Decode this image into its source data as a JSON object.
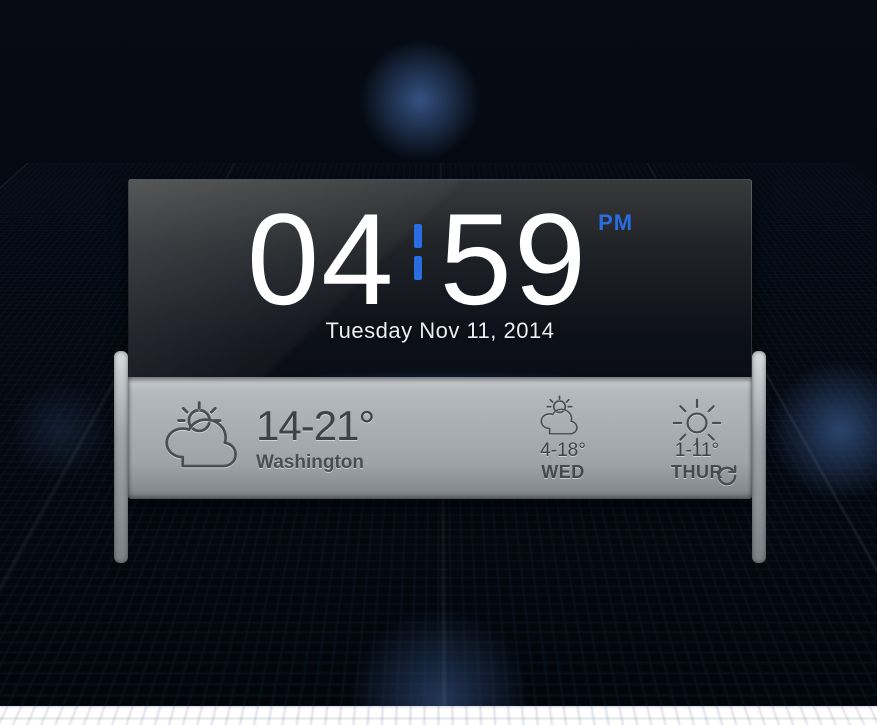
{
  "clock": {
    "hour": "04",
    "minute": "59",
    "ampm": "PM",
    "date": "Tuesday Nov 11, 2014"
  },
  "weather": {
    "today": {
      "icon": "partly-cloudy",
      "temp_range": "14-21°",
      "location": "Washington"
    },
    "forecast": [
      {
        "icon": "partly-cloudy",
        "temp_range": "4-18°",
        "day": "WED"
      },
      {
        "icon": "sunny",
        "temp_range": "1-11°",
        "day": "THUR"
      }
    ]
  },
  "colors": {
    "accent_blue": "#2a6de0"
  }
}
